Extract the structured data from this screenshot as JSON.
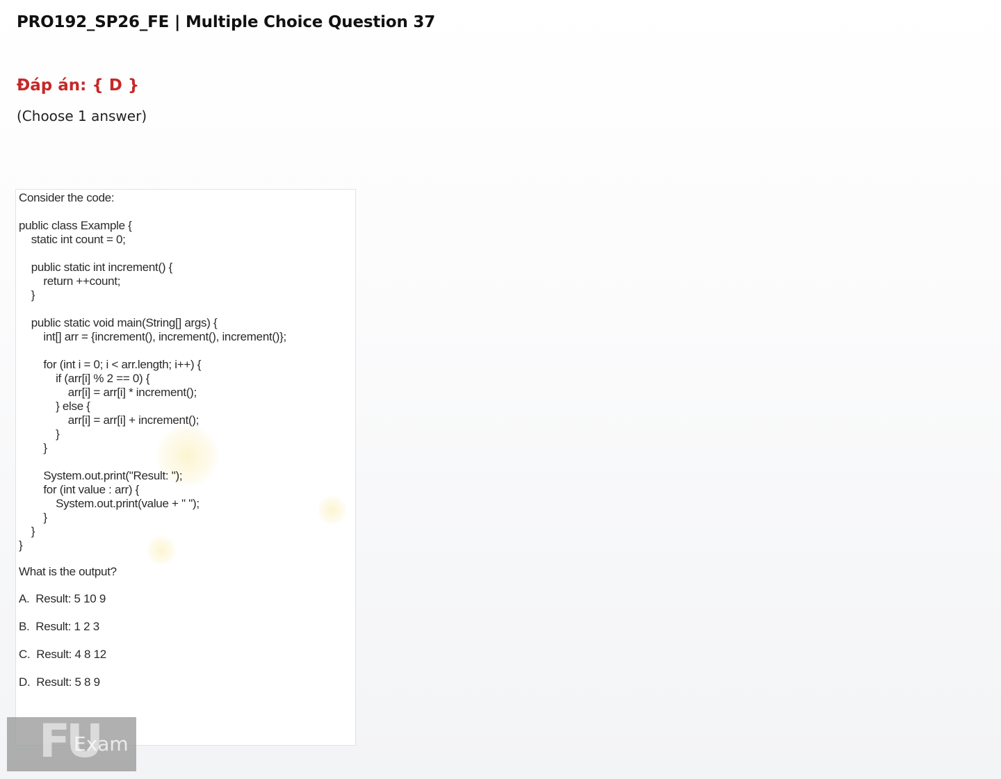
{
  "header": {
    "title": "PRO192_SP26_FE | Multiple Choice Question 37"
  },
  "answer": {
    "text": "Đáp án: { D }"
  },
  "instruction": {
    "text": "(Choose 1 answer)"
  },
  "question": {
    "intro": "Consider the code:",
    "code_lines": [
      "public class Example {",
      "    static int count = 0;",
      "",
      "    public static int increment() {",
      "        return ++count;",
      "    }",
      "",
      "    public static void main(String[] args) {",
      "        int[] arr = {increment(), increment(), increment()};",
      "",
      "        for (int i = 0; i < arr.length; i++) {",
      "            if (arr[i] % 2 == 0) {",
      "                arr[i] = arr[i] * increment();",
      "            } else {",
      "                arr[i] = arr[i] + increment();",
      "            }",
      "        }",
      "",
      "        System.out.print(\"Result: \");",
      "        for (int value : arr) {",
      "            System.out.print(value + \" \");",
      "        }",
      "    }",
      "}"
    ],
    "prompt": "What is the output?",
    "options": [
      "A.  Result: 5 10 9",
      "B.  Result: 1 2 3",
      "C.  Result: 4 8 12",
      "D.  Result: 5 8 9"
    ]
  },
  "watermark": {
    "text": "Exam"
  }
}
